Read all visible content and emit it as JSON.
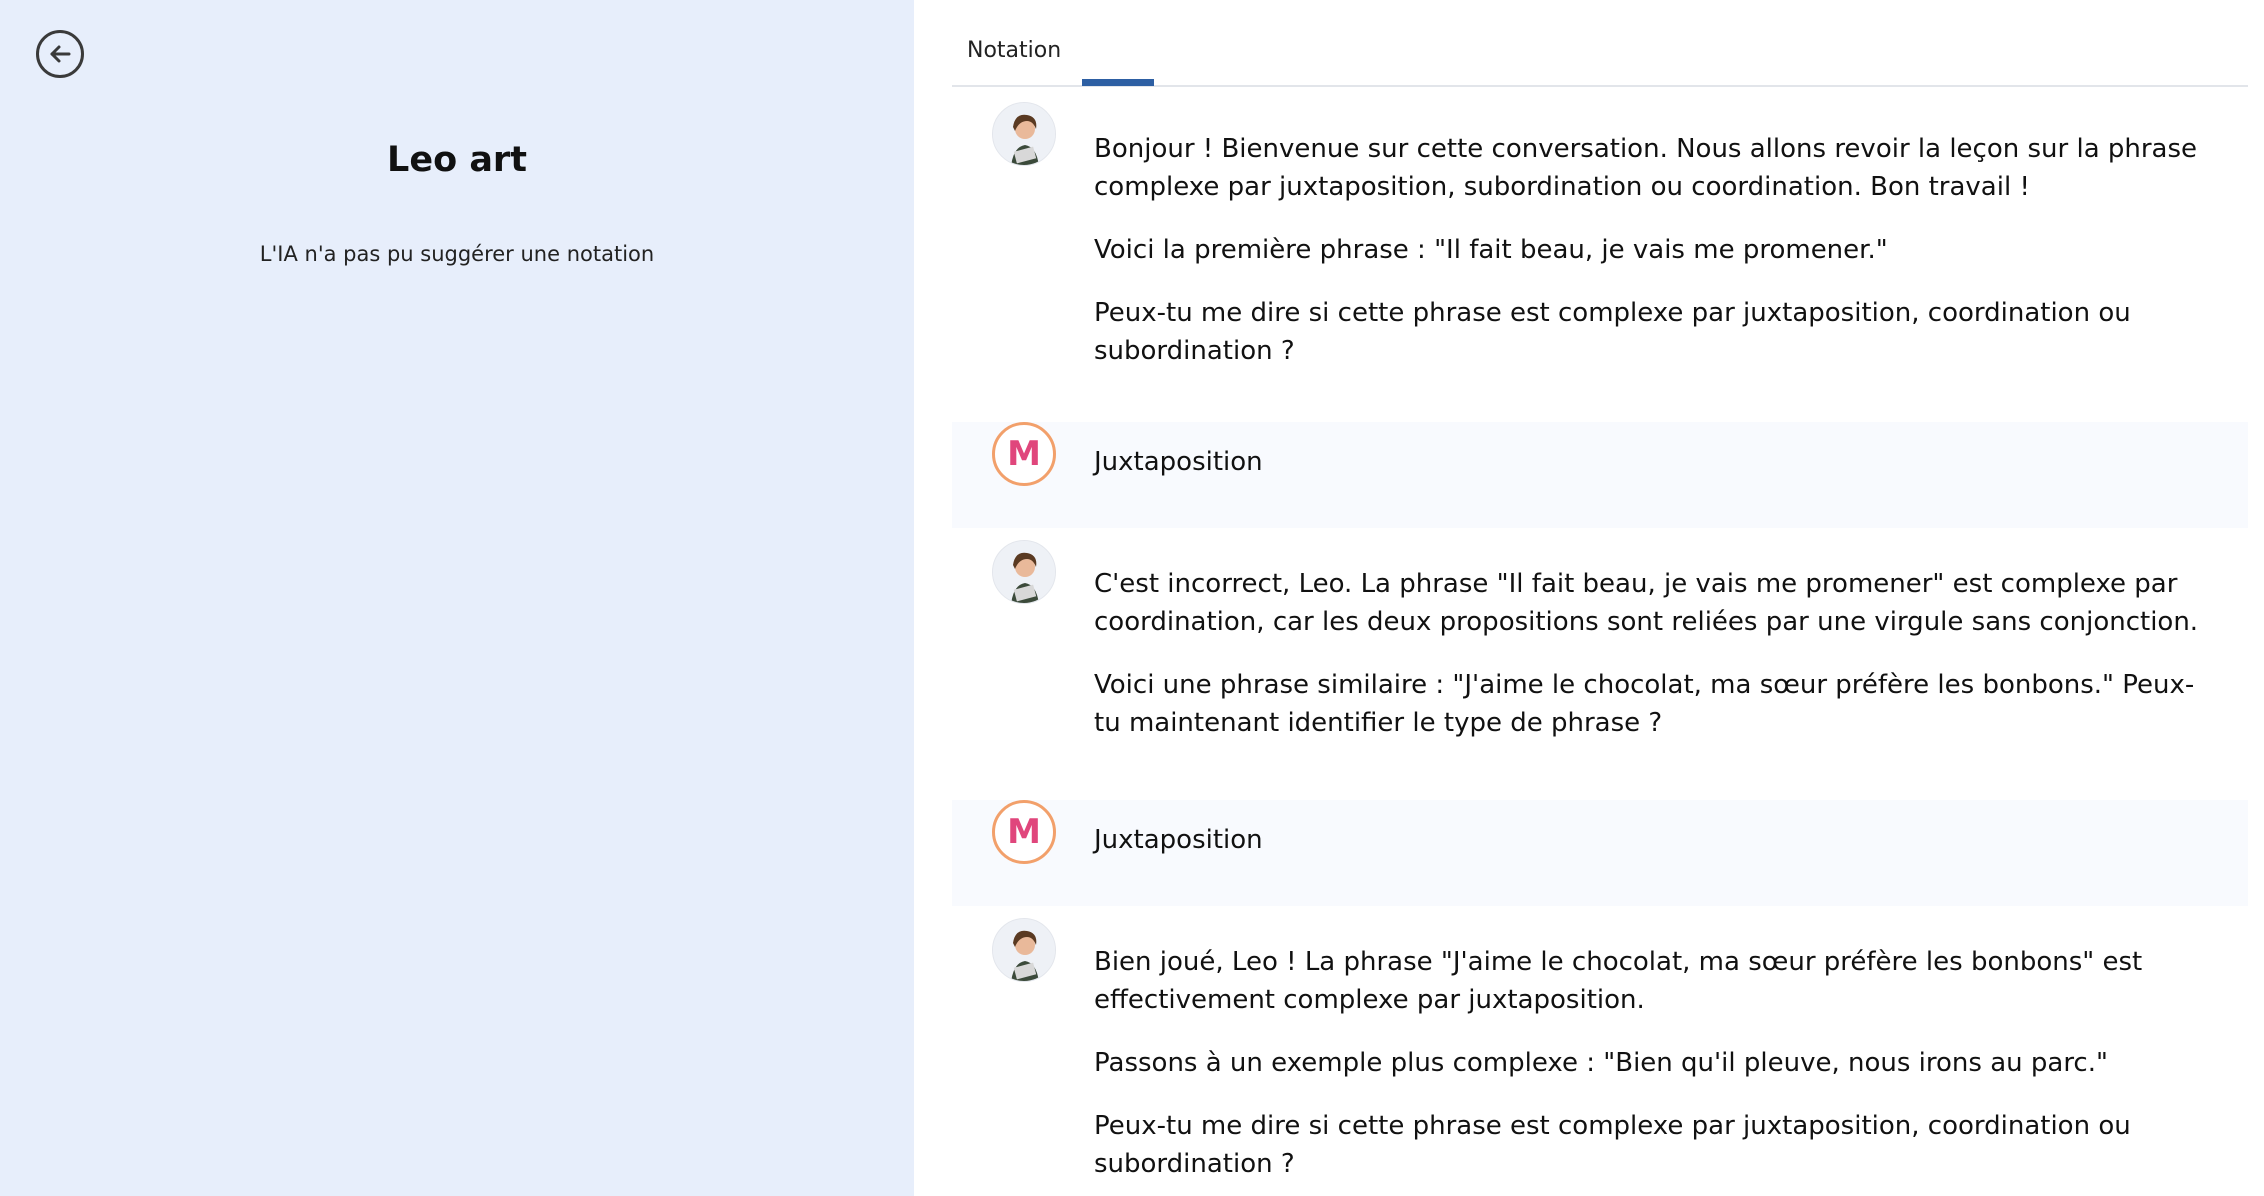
{
  "left": {
    "back_label": "Retour",
    "student_name": "Leo art",
    "notation_message": "L'IA n'a pas pu suggérer une notation"
  },
  "tabs": [
    {
      "label": "Notation",
      "active": true
    }
  ],
  "colors": {
    "left_bg": "#e7eefb",
    "tab_indicator": "#2d5fa3",
    "user_msg_bg": "#f8fafe",
    "user_logo": "#e0467c"
  },
  "conversation": [
    {
      "role": "assistant",
      "avatar": "tutor-avatar-icon",
      "paragraphs": [
        "Bonjour ! Bienvenue sur cette conversation. Nous allons revoir la leçon sur la phrase complexe par juxtaposition, subordination ou coordination. Bon travail !",
        "Voici la première phrase : \"Il fait beau, je vais me promener.\"",
        "Peux-tu me dire si cette phrase est complexe par juxtaposition, coordination ou subordination ?"
      ]
    },
    {
      "role": "user",
      "avatar": "user-logo-icon",
      "avatar_letter": "M",
      "paragraphs": [
        "Juxtaposition"
      ]
    },
    {
      "role": "assistant",
      "avatar": "tutor-avatar-icon",
      "paragraphs": [
        "C'est incorrect, Leo. La phrase \"Il fait beau, je vais me promener\" est complexe par coordination, car les deux propositions sont reliées par une virgule sans conjonction.",
        "Voici une phrase similaire : \"J'aime le chocolat, ma sœur préfère les bonbons.\" Peux-tu maintenant identifier le type de phrase ?"
      ]
    },
    {
      "role": "user",
      "avatar": "user-logo-icon",
      "avatar_letter": "M",
      "paragraphs": [
        "Juxtaposition"
      ]
    },
    {
      "role": "assistant",
      "avatar": "tutor-avatar-icon",
      "paragraphs": [
        "Bien joué, Leo ! La phrase \"J'aime le chocolat, ma sœur préfère les bonbons\" est effectivement complexe par juxtaposition.",
        "Passons à un exemple plus complexe : \"Bien qu'il pleuve, nous irons au parc.\"",
        "Peux-tu me dire si cette phrase est complexe par juxtaposition, coordination ou subordination ?"
      ]
    }
  ]
}
